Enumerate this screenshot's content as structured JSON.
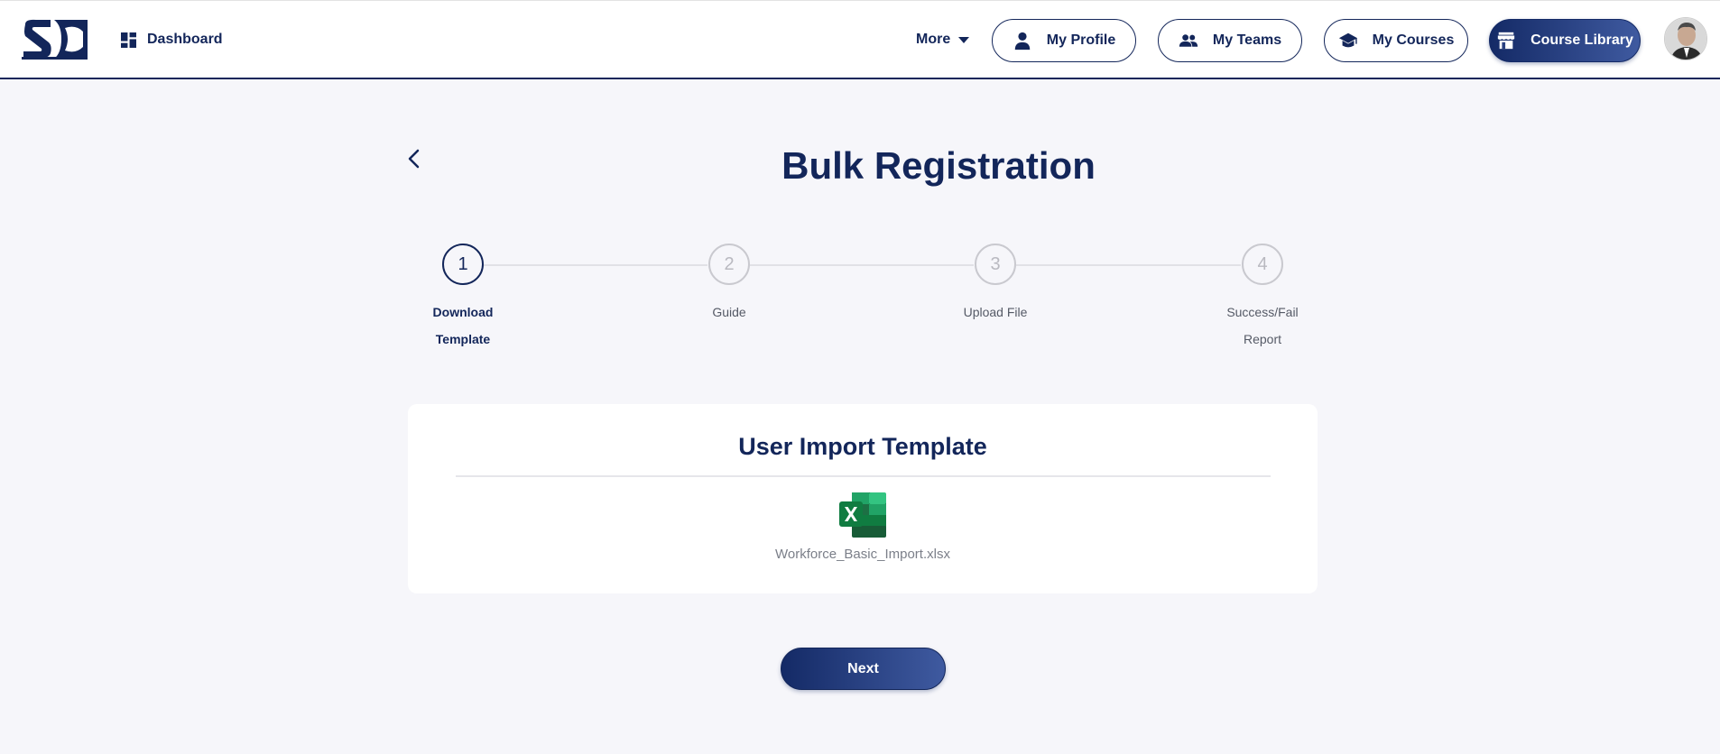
{
  "header": {
    "logo_text": "SC",
    "dashboard_label": "Dashboard",
    "more_label": "More",
    "nav": [
      {
        "label": "My Profile",
        "icon": "person-icon"
      },
      {
        "label": "My Teams",
        "icon": "people-icon"
      },
      {
        "label": "My Courses",
        "icon": "graduation-cap-icon"
      },
      {
        "label": "Course Library",
        "icon": "storefront-icon"
      }
    ],
    "avatar_alt": "user-avatar"
  },
  "page": {
    "title": "Bulk Registration"
  },
  "stepper": {
    "steps": [
      {
        "number": "1",
        "label_line1": "Download",
        "label_line2": "Template",
        "active": true
      },
      {
        "number": "2",
        "label_line1": "Guide",
        "label_line2": "",
        "active": false
      },
      {
        "number": "3",
        "label_line1": "Upload File",
        "label_line2": "",
        "active": false
      },
      {
        "number": "4",
        "label_line1": "Success/Fail",
        "label_line2": "Report",
        "active": false
      }
    ]
  },
  "template_card": {
    "title": "User Import Template",
    "file_name": "Workforce_Basic_Import.xlsx",
    "file_icon": "excel-icon"
  },
  "actions": {
    "next_label": "Next"
  },
  "colors": {
    "brand": "#13265a",
    "brand_gradient_end": "#3f5aa0",
    "background": "#f6f6fa",
    "excel_green": "#1d7044"
  }
}
